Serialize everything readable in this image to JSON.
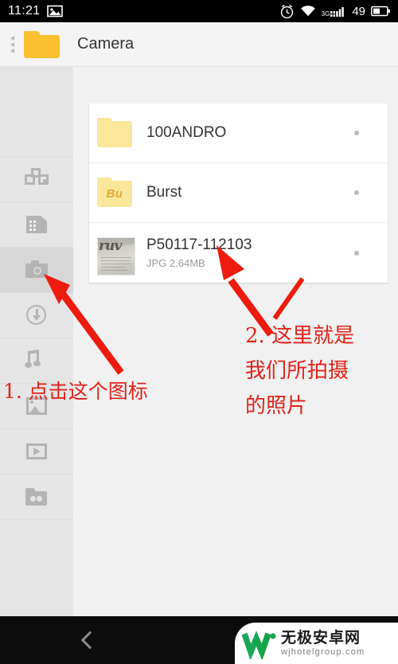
{
  "status_bar": {
    "time": "11:21",
    "left_icons": [
      "image-icon"
    ],
    "right_icons": [
      "alarm-icon",
      "wifi-icon",
      "signal-3g-icon",
      "battery-icon"
    ],
    "network_label": "3G",
    "battery_level": "49"
  },
  "title_bar": {
    "back_indicator": "back-chevrons",
    "folder_icon": "folder-icon",
    "title": "Camera",
    "folder_color": "#fbc02d"
  },
  "sidebar": {
    "items": [
      {
        "id": "categories",
        "icon": "categories-icon",
        "selected": false
      },
      {
        "id": "sdcard",
        "icon": "sdcard-icon",
        "selected": false
      },
      {
        "id": "camera",
        "icon": "camera-icon",
        "selected": true
      },
      {
        "id": "downloads",
        "icon": "download-icon",
        "selected": false
      },
      {
        "id": "music",
        "icon": "music-note-icon",
        "selected": false
      },
      {
        "id": "images",
        "icon": "image-icon",
        "selected": false
      },
      {
        "id": "videos",
        "icon": "video-play-icon",
        "selected": false
      },
      {
        "id": "archives",
        "icon": "archive-folder-icon",
        "selected": false
      }
    ],
    "background": "#e5e5e5",
    "selected_background": "#d7d7d7"
  },
  "file_list": {
    "rows": [
      {
        "name": "100ANDRO",
        "subtitle": "",
        "thumb_type": "folder",
        "thumb_label": "",
        "menu_dot": "more-dot"
      },
      {
        "name": "Burst",
        "subtitle": "",
        "thumb_type": "folder",
        "thumb_label": "Bu",
        "menu_dot": "more-dot"
      },
      {
        "name": "P50117-112103",
        "subtitle": "JPG 2.64MB",
        "thumb_type": "photo",
        "thumb_label": "ruv",
        "menu_dot": "more-dot"
      }
    ]
  },
  "annotations": {
    "color": "#e2231a",
    "note1": "1. 点击这个图标",
    "note2_line1": "2. 这里就是",
    "note2_line2": "我们所拍摄",
    "note2_line3": "的照片",
    "arrow1": "red-arrow-to-camera-icon",
    "arrow2": "red-arrow-to-photo-row"
  },
  "nav_bar": {
    "back_icon": "back-chevron-icon"
  },
  "watermark": {
    "logo": "w-logo-icon",
    "brand_cn": "无极安卓网",
    "brand_url": "wjhotelgroup.com",
    "logo_color": "#1aa75a"
  }
}
